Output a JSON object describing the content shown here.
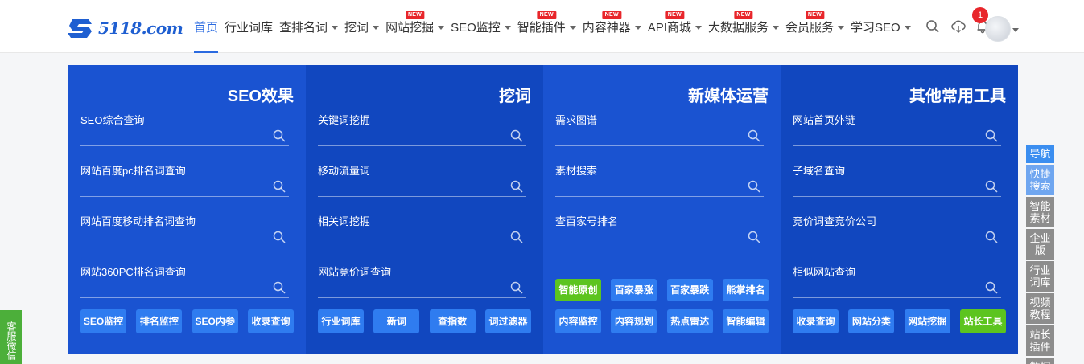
{
  "header": {
    "logo_text": "5118.com",
    "nav": [
      {
        "label": "首页",
        "active": true,
        "caret": false,
        "new": false
      },
      {
        "label": "行业词库",
        "active": false,
        "caret": false,
        "new": false
      },
      {
        "label": "查排名词",
        "active": false,
        "caret": true,
        "new": false
      },
      {
        "label": "挖词",
        "active": false,
        "caret": true,
        "new": false
      },
      {
        "label": "网站挖掘",
        "active": false,
        "caret": true,
        "new": true
      },
      {
        "label": "SEO监控",
        "active": false,
        "caret": true,
        "new": false
      },
      {
        "label": "智能插件",
        "active": false,
        "caret": true,
        "new": true
      },
      {
        "label": "内容神器",
        "active": false,
        "caret": true,
        "new": true
      },
      {
        "label": "API商城",
        "active": false,
        "caret": true,
        "new": true
      },
      {
        "label": "大数据服务",
        "active": false,
        "caret": true,
        "new": true
      },
      {
        "label": "会员服务",
        "active": false,
        "caret": true,
        "new": true
      },
      {
        "label": "学习SEO",
        "active": false,
        "caret": true,
        "new": false
      }
    ],
    "new_badge": "NEW",
    "notification_count": "1",
    "tools": [
      "search-icon",
      "cloud-download-icon",
      "bell-icon"
    ]
  },
  "panels": [
    {
      "title": "SEO效果",
      "rows": [
        "SEO综合查询",
        "网站百度pc排名词查询",
        "网站百度移动排名词查询",
        "网站360PC排名词查询"
      ],
      "buttons": [
        {
          "label": "SEO监控",
          "green": false
        },
        {
          "label": "排名监控",
          "green": false
        },
        {
          "label": "SEO内参",
          "green": false
        },
        {
          "label": "收录查询",
          "green": false
        }
      ]
    },
    {
      "title": "挖词",
      "rows": [
        "关键词挖掘",
        "移动流量词",
        "相关词挖掘",
        "网站竞价词查询"
      ],
      "buttons": [
        {
          "label": "行业词库",
          "green": false
        },
        {
          "label": "新词",
          "green": false
        },
        {
          "label": "查指数",
          "green": false
        },
        {
          "label": "词过滤器",
          "green": false
        }
      ]
    },
    {
      "title": "新媒体运营",
      "rows": [
        "需求图谱",
        "素材搜索",
        "查百家号排名"
      ],
      "buttons_top": [
        {
          "label": "智能原创",
          "green": true
        },
        {
          "label": "百家暴涨",
          "green": false
        },
        {
          "label": "百家暴跌",
          "green": false
        },
        {
          "label": "熊掌排名",
          "green": false
        }
      ],
      "buttons": [
        {
          "label": "内容监控",
          "green": false
        },
        {
          "label": "内容规划",
          "green": false
        },
        {
          "label": "热点雷达",
          "green": false
        },
        {
          "label": "智能编辑",
          "green": false
        }
      ]
    },
    {
      "title": "其他常用工具",
      "rows": [
        "网站首页外链",
        "子域名查询",
        "竞价词查竞价公司",
        "相似网站查询"
      ],
      "buttons": [
        {
          "label": "收录查询",
          "green": false
        },
        {
          "label": "网站分类",
          "green": false
        },
        {
          "label": "网站挖掘",
          "green": false
        },
        {
          "label": "站长工具",
          "green": true
        }
      ]
    }
  ],
  "rail": [
    {
      "label": "导航",
      "state": "active"
    },
    {
      "label": "快捷搜索",
      "state": "light"
    },
    {
      "label": "智能素材",
      "state": "normal"
    },
    {
      "label": "企业版",
      "state": "normal"
    },
    {
      "label": "行业词库",
      "state": "normal"
    },
    {
      "label": "视频教程",
      "state": "normal"
    },
    {
      "label": "站长插件",
      "state": "normal"
    },
    {
      "label": "数据",
      "state": "normal"
    }
  ],
  "left_tab": "客服微信",
  "colors": {
    "brand": "#1f5fd1",
    "panel_a": "#1a53d1",
    "panel_b": "#1147bf",
    "button": "#2f7cf0",
    "button_green": "#5cc41f",
    "badge_red": "#e8262b"
  }
}
